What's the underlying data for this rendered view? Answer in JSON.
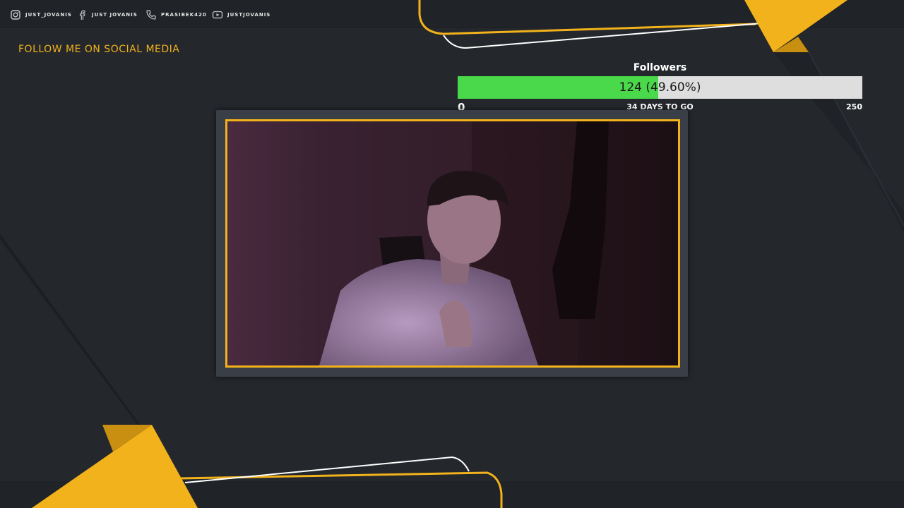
{
  "colors": {
    "accent": "#f2b21b",
    "background": "#24272c",
    "progress_fill": "#4ad94a",
    "progress_track": "#dedede"
  },
  "social": [
    {
      "icon": "instagram-icon",
      "label": "JUST_JOVANIS"
    },
    {
      "icon": "facebook-icon",
      "label": "JUST JOVANIS"
    },
    {
      "icon": "phone-icon",
      "label": "PRASIBEK420"
    },
    {
      "icon": "youtube-icon",
      "label": "JUSTJOVANIS"
    }
  ],
  "follow_cta": "FOLLOW ME ON SOCIAL MEDIA",
  "goal": {
    "title": "Followers",
    "current": 124,
    "max": 250,
    "progress_fraction": 0.496,
    "progress_text": "124 (49.60%)",
    "min_label": "0",
    "max_label": "250",
    "days_label": "34 DAYS TO GO"
  },
  "webcam": {
    "description_icon": "webcam-feed"
  }
}
